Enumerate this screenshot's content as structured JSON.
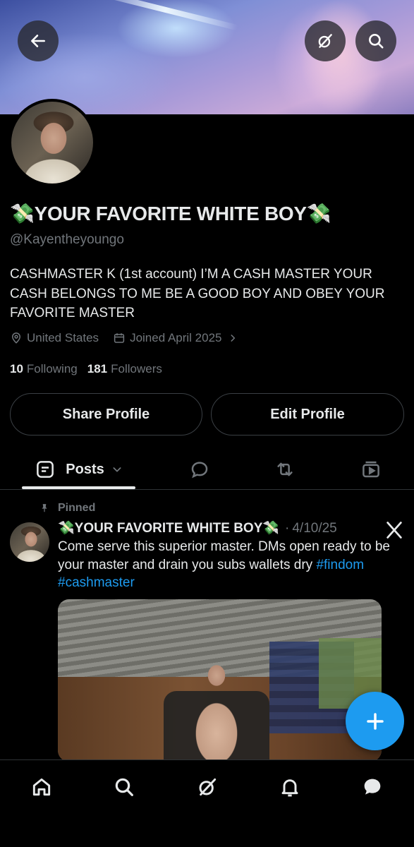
{
  "profile": {
    "display_name": "💸YOUR FAVORITE WHITE BOY💸",
    "handle": "@Kayentheyoungo",
    "bio": "CASHMASTER K (1st account) I’M A CASH MASTER YOUR CASH BELONGS TO ME BE A GOOD BOY AND OBEY YOUR FAVORITE MASTER",
    "location": "United States",
    "joined": "Joined April 2025",
    "following_count": "10",
    "following_label": "Following",
    "followers_count": "181",
    "followers_label": "Followers"
  },
  "buttons": {
    "share_profile": "Share Profile",
    "edit_profile": "Edit Profile"
  },
  "tabs": {
    "posts_label": "Posts"
  },
  "post": {
    "pinned_label": "Pinned",
    "author_name": "💸YOUR FAVORITE WHITE BOY💸",
    "date": "4/10/25",
    "text": "Come serve this superior master. DMs open ready to be your master and drain you subs wallets dry ",
    "hashtag_1": "#findom",
    "hashtag_2": "#cashmaster"
  },
  "colors": {
    "accent": "#1d9bf0",
    "background": "#000000",
    "text_primary": "#e7e9ea",
    "text_secondary": "#71767b",
    "border": "#2f3336"
  },
  "icons": {
    "header": [
      "back-arrow-icon",
      "grok-icon",
      "search-icon"
    ],
    "meta": [
      "location-icon",
      "calendar-icon",
      "chevron-right-icon"
    ],
    "tabs": [
      "posts-icon",
      "chevron-down-icon",
      "reply-icon",
      "repost-icon",
      "media-icon"
    ],
    "post": [
      "pin-icon",
      "x-logo-icon"
    ],
    "bottom_nav": [
      "home-icon",
      "search-icon",
      "grok-icon",
      "notifications-icon",
      "messages-icon"
    ],
    "fab": "plus-icon"
  }
}
